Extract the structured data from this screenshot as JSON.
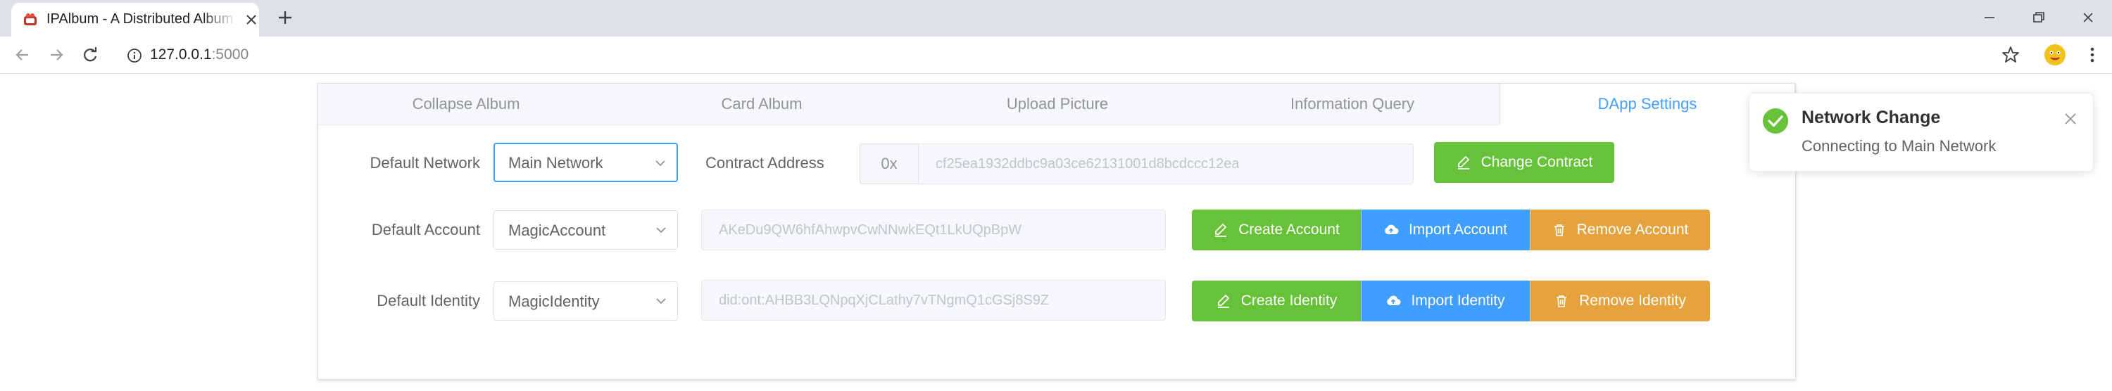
{
  "browser": {
    "tab_title": "IPAlbum - A Distributed Album",
    "url_host": "127.0.0.1",
    "url_port": ":5000",
    "icons": {
      "favicon": "app-favicon-icon",
      "close": "close-icon",
      "new_tab": "plus-icon",
      "back": "back-arrow-icon",
      "forward": "forward-arrow-icon",
      "reload": "reload-icon",
      "info": "info-icon",
      "bookmark": "star-icon",
      "profile": "avatar",
      "menu": "kebab-menu-icon"
    }
  },
  "app": {
    "tabs": [
      {
        "label": "Collapse Album"
      },
      {
        "label": "Card Album"
      },
      {
        "label": "Upload Picture"
      },
      {
        "label": "Information Query"
      },
      {
        "label": "DApp Settings",
        "active": true
      }
    ],
    "network": {
      "label": "Default Network",
      "selected": "Main Network",
      "contract_label": "Contract Address",
      "contract_prefix": "0x",
      "contract_value": "cf25ea1932ddbc9a03ce62131001d8bcdccc12ea",
      "change_button": "Change Contract"
    },
    "account": {
      "label": "Default Account",
      "selected": "MagicAccount",
      "address": "AKeDu9QW6hfAhwpvCwNNwkEQt1LkUQpBpW",
      "create_button": "Create Account",
      "import_button": "Import Account",
      "remove_button": "Remove Account"
    },
    "identity": {
      "label": "Default Identity",
      "selected": "MagicIdentity",
      "ontid": "did:ont:AHBB3LQNpqXjCLathy7vTNgmQ1cGSj8S9Z",
      "create_button": "Create Identity",
      "import_button": "Import Identity",
      "remove_button": "Remove Identity"
    }
  },
  "notification": {
    "title": "Network Change",
    "message": "Connecting to Main Network"
  },
  "colors": {
    "primary": "#409eff",
    "success": "#67c23a",
    "warning": "#e6a23c"
  }
}
